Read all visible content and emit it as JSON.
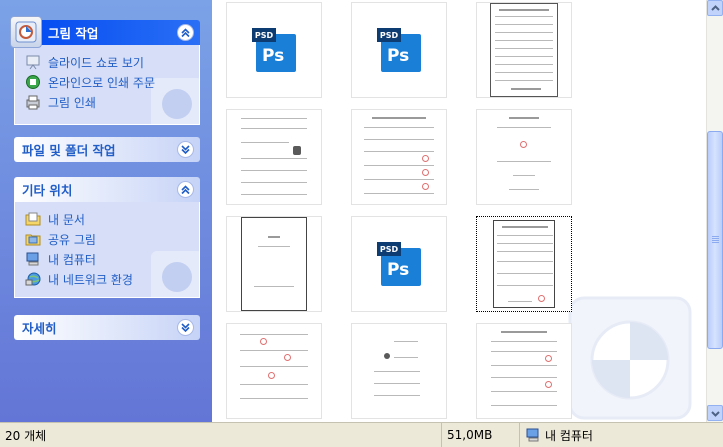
{
  "taskpane": {
    "picture_tasks": {
      "title": "그림 작업",
      "items": [
        {
          "label": "슬라이드 쇼로 보기",
          "icon": "slideshow-icon"
        },
        {
          "label": "온라인으로 인쇄 주문",
          "icon": "order-prints-online-icon"
        },
        {
          "label": "그림 인쇄",
          "icon": "print-pictures-icon"
        }
      ]
    },
    "file_folder_tasks": {
      "title": "파일 및 폴더 작업"
    },
    "other_places": {
      "title": "기타 위치",
      "items": [
        {
          "label": "내 문서",
          "icon": "my-documents-icon"
        },
        {
          "label": "공유 그림",
          "icon": "shared-pictures-icon"
        },
        {
          "label": "내 컴퓨터",
          "icon": "my-computer-icon"
        },
        {
          "label": "내 네트워크 환경",
          "icon": "my-network-places-icon"
        }
      ]
    },
    "details": {
      "title": "자세히"
    }
  },
  "thumbnails": {
    "psd_badge": "PSD",
    "psd_text": "Ps",
    "items": [
      {
        "kind": "psd"
      },
      {
        "kind": "psd"
      },
      {
        "kind": "document"
      },
      {
        "kind": "document"
      },
      {
        "kind": "document"
      },
      {
        "kind": "document"
      },
      {
        "kind": "document"
      },
      {
        "kind": "psd"
      },
      {
        "kind": "document",
        "selected": true
      },
      {
        "kind": "document"
      },
      {
        "kind": "document"
      },
      {
        "kind": "document"
      }
    ]
  },
  "statusbar": {
    "object_count": "20 개체",
    "size": "51,0MB",
    "location": "내 컴퓨터",
    "location_icon": "my-computer-icon"
  },
  "colors": {
    "taskpane_gradient_top": "#7ba2e7",
    "taskpane_gradient_bottom": "#6375d6",
    "link": "#215dc6",
    "special_header": "#0048f1",
    "psd_blue": "#1a7fd6"
  }
}
